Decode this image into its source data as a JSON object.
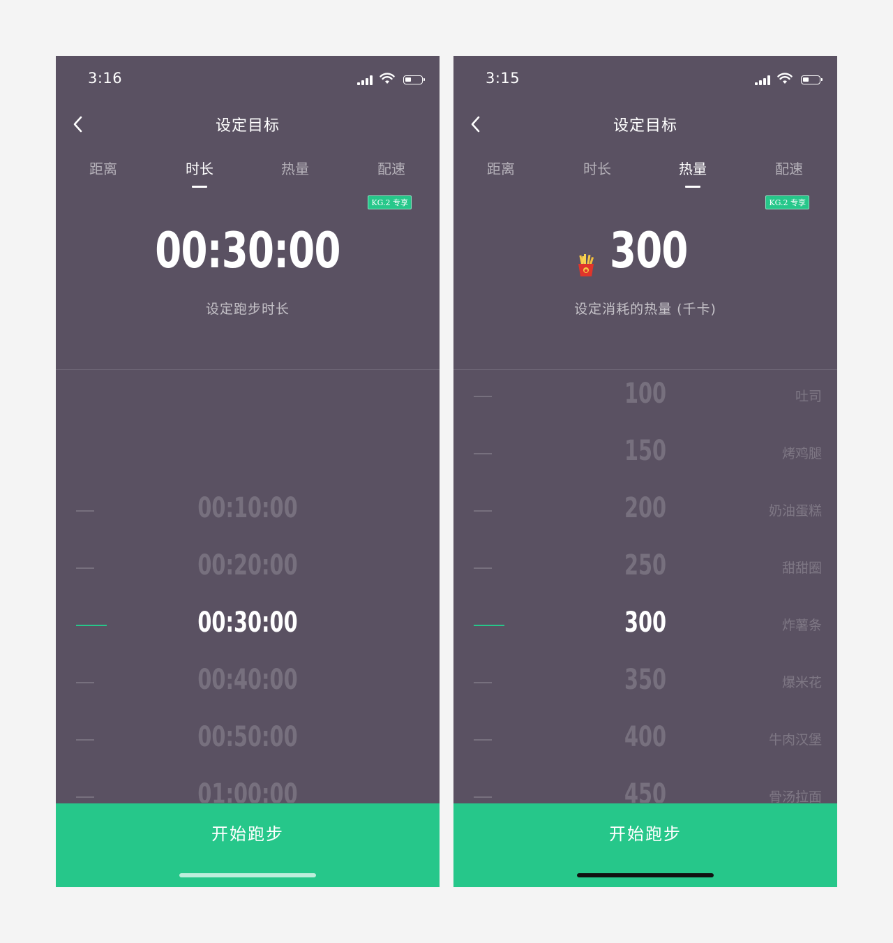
{
  "left": {
    "status": {
      "time": "3:16"
    },
    "nav": {
      "title": "设定目标"
    },
    "tabs": [
      {
        "label": "距离"
      },
      {
        "label": "时长"
      },
      {
        "label": "热量"
      },
      {
        "label": "配速"
      }
    ],
    "active_tab": "时长",
    "badge": "KG.2 专享",
    "hero": {
      "value": "00:30:00",
      "label": "设定跑步时长"
    },
    "picker": {
      "rows": [
        {
          "value": "00:10:00"
        },
        {
          "value": "00:20:00"
        },
        {
          "value": "00:30:00"
        },
        {
          "value": "00:40:00"
        },
        {
          "value": "00:50:00"
        },
        {
          "value": "01:00:00"
        }
      ],
      "selected": "00:30:00"
    },
    "cta": {
      "label": "开始跑步"
    }
  },
  "right": {
    "status": {
      "time": "3:15"
    },
    "nav": {
      "title": "设定目标"
    },
    "tabs": [
      {
        "label": "距离"
      },
      {
        "label": "时长"
      },
      {
        "label": "热量"
      },
      {
        "label": "配速"
      }
    ],
    "active_tab": "热量",
    "badge": "KG.2 专享",
    "hero": {
      "value": "300",
      "label": "设定消耗的热量 (千卡)",
      "icon": "fries-icon"
    },
    "picker": {
      "rows": [
        {
          "value": "100",
          "food": "吐司"
        },
        {
          "value": "150",
          "food": "烤鸡腿"
        },
        {
          "value": "200",
          "food": "奶油蛋糕"
        },
        {
          "value": "250",
          "food": "甜甜圈"
        },
        {
          "value": "300",
          "food": "炸薯条"
        },
        {
          "value": "350",
          "food": "爆米花"
        },
        {
          "value": "400",
          "food": "牛肉汉堡"
        },
        {
          "value": "450",
          "food": "骨汤拉面"
        }
      ],
      "selected": "300"
    },
    "cta": {
      "label": "开始跑步"
    }
  },
  "colors": {
    "background": "#5a5162",
    "accent": "#26c78a",
    "page": "#f4f4f4"
  }
}
